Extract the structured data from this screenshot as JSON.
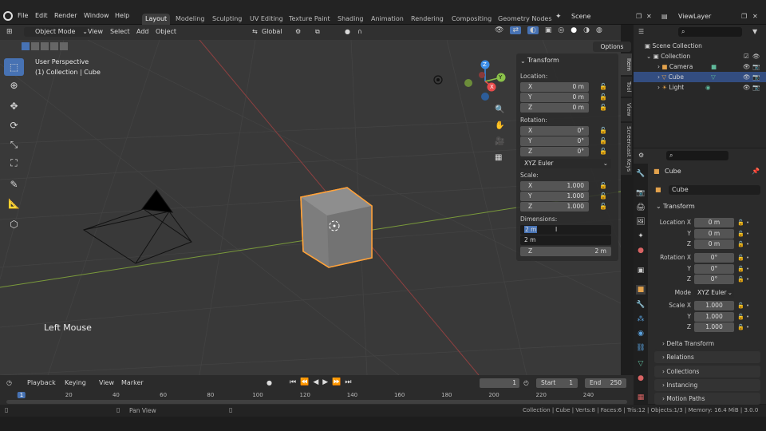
{
  "menu": [
    "File",
    "Edit",
    "Render",
    "Window",
    "Help"
  ],
  "workspaces": [
    "Layout",
    "Modeling",
    "Sculpting",
    "UV Editing",
    "Texture Paint",
    "Shading",
    "Animation",
    "Rendering",
    "Compositing",
    "Geometry Nodes"
  ],
  "scene": "Scene",
  "view_layer": "ViewLayer",
  "viewport_header": {
    "mode": "Object Mode",
    "menus": [
      "View",
      "Select",
      "Add",
      "Object"
    ],
    "orientation": "Global",
    "options": "Options"
  },
  "viewport": {
    "perspective": "User Perspective",
    "context": "(1) Collection | Cube",
    "key_hint": "Left Mouse"
  },
  "gizmo": {
    "z": "Z",
    "y": "Y",
    "x": "X"
  },
  "npanel": {
    "title": "Transform",
    "location_label": "Location:",
    "location": [
      {
        "axis": "X",
        "value": "0 m"
      },
      {
        "axis": "Y",
        "value": "0 m"
      },
      {
        "axis": "Z",
        "value": "0 m"
      }
    ],
    "rotation_label": "Rotation:",
    "rotation": [
      {
        "axis": "X",
        "value": "0°"
      },
      {
        "axis": "Y",
        "value": "0°"
      },
      {
        "axis": "Z",
        "value": "0°"
      }
    ],
    "rotation_mode": "XYZ Euler",
    "scale_label": "Scale:",
    "scale": [
      {
        "axis": "X",
        "value": "1.000"
      },
      {
        "axis": "Y",
        "value": "1.000"
      },
      {
        "axis": "Z",
        "value": "1.000"
      }
    ],
    "dimensions_label": "Dimensions:",
    "dim_editing": "2 m",
    "dim_y": "2 m",
    "dim_z_axis": "Z",
    "dim_z": "2 m"
  },
  "side_tabs": [
    "Item",
    "Tool",
    "View",
    "Screencast Keys"
  ],
  "outliner": {
    "rows": [
      "Scene Collection",
      "Collection",
      "Camera",
      "Cube",
      "Light"
    ]
  },
  "properties": {
    "object_name": "Cube",
    "data_name": "Cube",
    "transform": "Transform",
    "location_label": "Location X",
    "location": [
      "0 m",
      "0 m",
      "0 m"
    ],
    "rotation_label": "Rotation X",
    "rotation": [
      "0°",
      "0°",
      "0°"
    ],
    "mode_label": "Mode",
    "mode": "XYZ Euler",
    "scale_label": "Scale X",
    "scale": [
      "1.000",
      "1.000",
      "1.000"
    ],
    "axis_y": "Y",
    "axis_z": "Z",
    "sections": [
      "Delta Transform",
      "Relations",
      "Collections",
      "Instancing",
      "Motion Paths"
    ]
  },
  "timeline": {
    "menus": [
      "Playback",
      "Keying",
      "View",
      "Marker"
    ],
    "current_frame": "1",
    "start_label": "Start",
    "start": "1",
    "end_label": "End",
    "end": "250",
    "ruler": [
      "1",
      "20",
      "40",
      "60",
      "80",
      "100",
      "120",
      "140",
      "160",
      "180",
      "200",
      "220",
      "240"
    ]
  },
  "status": {
    "hint": "Pan View",
    "info": "Collection | Cube | Verts:8 | Faces:6 | Tris:12 | Objects:1/3 | Memory: 16.4 MiB | 3.0.0"
  },
  "colors": {
    "accent": "#4772b3",
    "select": "#ffa23a",
    "x_axis": "#e84b4b",
    "y_axis": "#8bc34a",
    "z_axis": "#3b8ee8"
  }
}
